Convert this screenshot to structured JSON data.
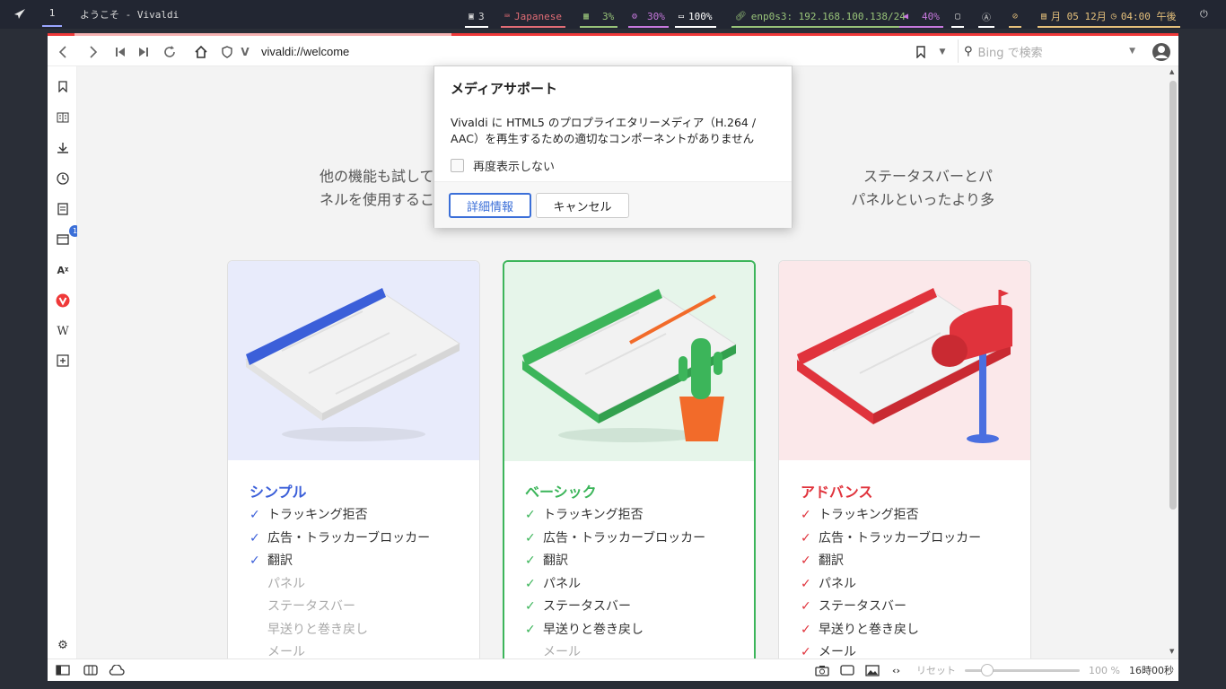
{
  "topbar": {
    "workspace": "1",
    "window_title": "ようこそ - Vivaldi",
    "windows_count": "3",
    "keyboard": "Japanese",
    "memory": "3%",
    "cpu": "30%",
    "battery": "100%",
    "network": "enp0s3: 192.168.100.138/24",
    "volume": "40%",
    "date": "月 05 12月",
    "time": "04:00 午後",
    "colors": {
      "keyboard": "#e06c75",
      "memory": "#98c379",
      "cpu": "#c678dd",
      "battery": "#ffffff",
      "network": "#98c379",
      "volume": "#c678dd",
      "date": "#e5c07b"
    }
  },
  "addressbar": {
    "url": "vivaldi://welcome",
    "search_placeholder": "Bing で検索"
  },
  "panel": {
    "badge": "1"
  },
  "intro": {
    "line1": "他の機能も試して",
    "line1_right": "ステータスバーとパ",
    "line2": "ネルを使用するこ",
    "line2_right": "パネルといったより多"
  },
  "cards": [
    {
      "title": "シンプル",
      "color": "#3b5fd9",
      "bg": "#e8ebfb",
      "features": [
        {
          "label": "トラッキング拒否",
          "on": true
        },
        {
          "label": "広告・トラッカーブロッカー",
          "on": true
        },
        {
          "label": "翻訳",
          "on": true
        },
        {
          "label": "パネル",
          "on": false
        },
        {
          "label": "ステータスバー",
          "on": false
        },
        {
          "label": "早送りと巻き戻し",
          "on": false
        },
        {
          "label": "メール",
          "on": false
        }
      ]
    },
    {
      "title": "ベーシック",
      "color": "#3cb55a",
      "bg": "#e6f5ea",
      "features": [
        {
          "label": "トラッキング拒否",
          "on": true
        },
        {
          "label": "広告・トラッカーブロッカー",
          "on": true
        },
        {
          "label": "翻訳",
          "on": true
        },
        {
          "label": "パネル",
          "on": true
        },
        {
          "label": "ステータスバー",
          "on": true
        },
        {
          "label": "早送りと巻き戻し",
          "on": true
        },
        {
          "label": "メール",
          "on": false
        }
      ]
    },
    {
      "title": "アドバンス",
      "color": "#e0333c",
      "bg": "#fbe8ea",
      "features": [
        {
          "label": "トラッキング拒否",
          "on": true
        },
        {
          "label": "広告・トラッカーブロッカー",
          "on": true
        },
        {
          "label": "翻訳",
          "on": true
        },
        {
          "label": "パネル",
          "on": true
        },
        {
          "label": "ステータスバー",
          "on": true
        },
        {
          "label": "早送りと巻き戻し",
          "on": true
        },
        {
          "label": "メール",
          "on": true
        }
      ]
    }
  ],
  "dialog": {
    "title": "メディアサポート",
    "message": "Vivaldi に HTML5 のプロプライエタリーメディア（H.264 / AAC）を再生するための適切なコンポーネントがありません",
    "checkbox": "再度表示しない",
    "primary": "詳細情報",
    "cancel": "キャンセル"
  },
  "status": {
    "reset": "リセット",
    "zoom": "100 %",
    "clock": "16時00秒"
  }
}
